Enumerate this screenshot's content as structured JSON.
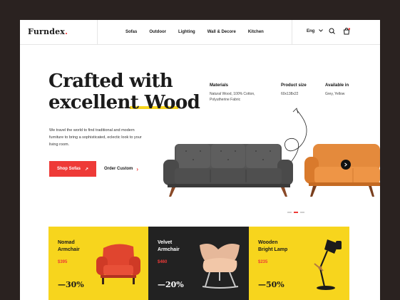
{
  "brand": {
    "name": "Furndex",
    "dot": ".",
    "accent": "#ee3a37",
    "yellow": "#f7d51d"
  },
  "nav": {
    "links": [
      "Sofas",
      "Outdoor",
      "Lighting",
      "Wall & Decore",
      "Kitchen"
    ],
    "language": "Eng",
    "icons": [
      "chevron-down-icon",
      "search-icon",
      "cart-icon"
    ]
  },
  "hero": {
    "title_line1": "Crafted with",
    "title_line2": "excellent Wood",
    "description": "We travel the world to find traditional and modern furniture to bring a sophisticated, eclectic look to your living room.",
    "shop_button": "Shop Sofas",
    "shop_arrow": "↗",
    "order_button": "Order Custom",
    "order_arrow": "›"
  },
  "specs": [
    {
      "heading": "Materials",
      "value": "Natural Wood, 100% Cotton, Polyutherine Fabric"
    },
    {
      "heading": "Product size",
      "value": "60x138x22"
    },
    {
      "heading": "Available in",
      "value": "Grey, Yellow"
    }
  ],
  "carousel": {
    "next_icon": "arrow-right-icon",
    "slides": 3,
    "active": 2
  },
  "cards": [
    {
      "title1": "Nomad",
      "title2": "Armchair",
      "price": "$395",
      "discount": "—30%",
      "bg": "#f7d51d",
      "fg": "#1b1b1b"
    },
    {
      "title1": "Velvet",
      "title2": "Armchair",
      "price": "$460",
      "discount": "—20%",
      "bg": "#222222",
      "fg": "#ffffff"
    },
    {
      "title1": "Wooden",
      "title2": "Bright Lamp",
      "price": "$235",
      "discount": "—50%",
      "bg": "#f7d51d",
      "fg": "#1b1b1b"
    }
  ]
}
